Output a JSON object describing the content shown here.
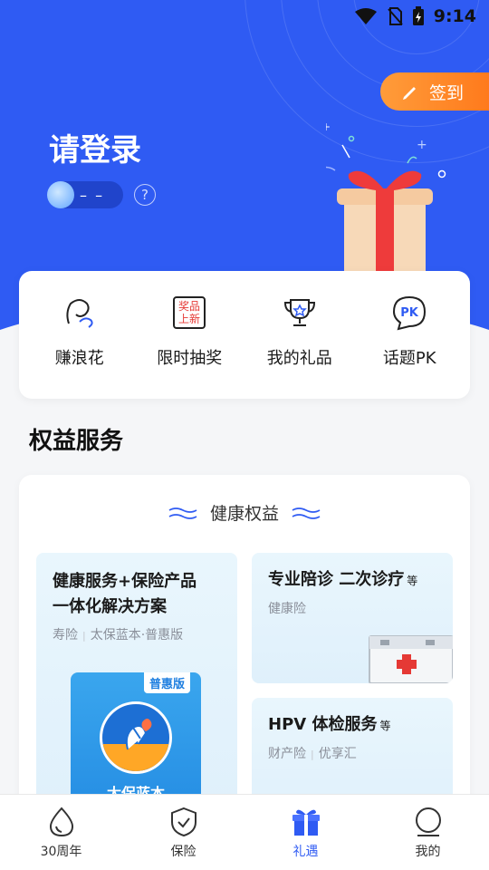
{
  "status_bar": {
    "time": "9:14"
  },
  "header": {
    "checkin_label": "签到",
    "login_title": "请登录",
    "level_value": "– –"
  },
  "quick_actions": [
    {
      "label": "赚浪花",
      "icon": "wave-ear-icon"
    },
    {
      "label": "限时抽奖",
      "icon": "lottery-icon",
      "icon_text_top": "奖品",
      "icon_text_bottom": "上新"
    },
    {
      "label": "我的礼品",
      "icon": "trophy-icon"
    },
    {
      "label": "话题PK",
      "icon": "pk-bubble-icon",
      "icon_text": "PK"
    }
  ],
  "section_title": "权益服务",
  "benefits": {
    "header": "健康权益",
    "tiles": [
      {
        "title_line1": "健康服务+保险产品",
        "title_line2": "一体化解决方案",
        "sub_a": "寿险",
        "sub_b": "太保蓝本·普惠版",
        "book_badge": "普惠版",
        "book_name": "太保蓝本"
      },
      {
        "title": "专业陪诊 二次诊疗",
        "suffix": "等",
        "sub_a": "健康险"
      },
      {
        "title": "HPV 体检服务",
        "suffix": "等",
        "sub_a": "财产险",
        "sub_b": "优享汇"
      }
    ]
  },
  "tabbar": [
    {
      "label": "30周年",
      "icon": "droplet-icon",
      "active": false
    },
    {
      "label": "保险",
      "icon": "shield-check-icon",
      "active": false
    },
    {
      "label": "礼遇",
      "icon": "gift-icon",
      "active": true
    },
    {
      "label": "我的",
      "icon": "user-icon",
      "active": false
    }
  ],
  "colors": {
    "primary": "#2f5bf3",
    "checkin": "#ff8a2a",
    "gift_red": "#f23a3a"
  }
}
